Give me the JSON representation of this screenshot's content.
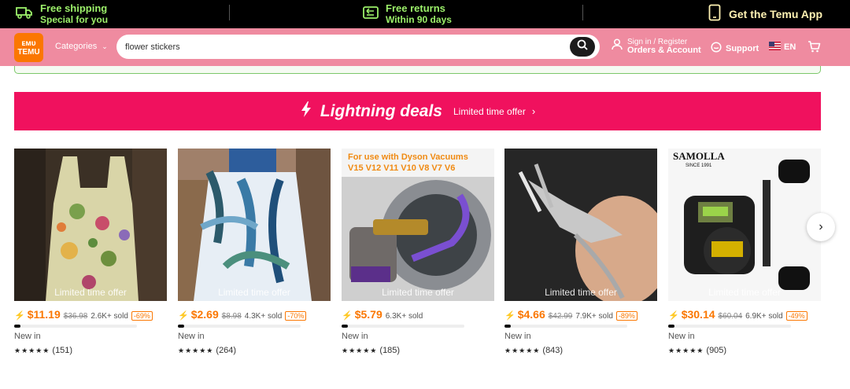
{
  "promo": {
    "shipping_line1": "Free shipping",
    "shipping_line2": "Special for you",
    "returns_line1": "Free returns",
    "returns_line2": "Within 90 days",
    "app_label": "Get the Temu App"
  },
  "header": {
    "logo_line1": "ᴇᴍᴜ",
    "logo_line2": "TEMU",
    "categories_label": "Categories",
    "search_value": "flower stickers",
    "account_line1": "Sign in / Register",
    "account_line2": "Orders & Account",
    "support_label": "Support",
    "language_label": "EN"
  },
  "deals": {
    "title": "Lightning deals",
    "subtitle": "Limited time offer"
  },
  "products": [
    {
      "offer_label": "Limited time offer",
      "price": "$11.19",
      "old_price": "$36.98",
      "sold": "2.6K+ sold",
      "discount": "-69%",
      "badge": "New in",
      "reviews": "(151)",
      "progress": 0.05
    },
    {
      "offer_label": "Limited time offer",
      "price": "$2.69",
      "old_price": "$8.98",
      "sold": "4.3K+ sold",
      "discount": "-70%",
      "badge": "New in",
      "reviews": "(264)",
      "progress": 0.05
    },
    {
      "offer_label": "Limited time offer",
      "price": "$5.79",
      "old_price": "",
      "sold": "6.3K+ sold",
      "discount": "",
      "badge": "New in",
      "reviews": "(185)",
      "progress": 0.05,
      "image_text_1": "For use with Dyson Vacuums",
      "image_text_2": "V15 V12 V11 V10 V8 V7 V6"
    },
    {
      "offer_label": "Limited time offer",
      "price": "$4.66",
      "old_price": "$42.99",
      "sold": "7.9K+ sold",
      "discount": "-89%",
      "badge": "New in",
      "reviews": "(843)",
      "progress": 0.05
    },
    {
      "offer_label": "Limited time offer",
      "price": "$30.14",
      "old_price": "$60.04",
      "sold": "6.9K+ sold",
      "discount": "-49%",
      "badge": "New in",
      "reviews": "(905)",
      "progress": 0.05,
      "image_text_1": "SAMOLLA",
      "image_text_2": "SINCE 1991"
    }
  ],
  "stars": "★★★★★",
  "colors": {
    "brand_orange": "#fb7701",
    "deals_pink": "#f0115e",
    "header_pink": "#ef8ba0",
    "promo_green": "#9cf06a"
  }
}
